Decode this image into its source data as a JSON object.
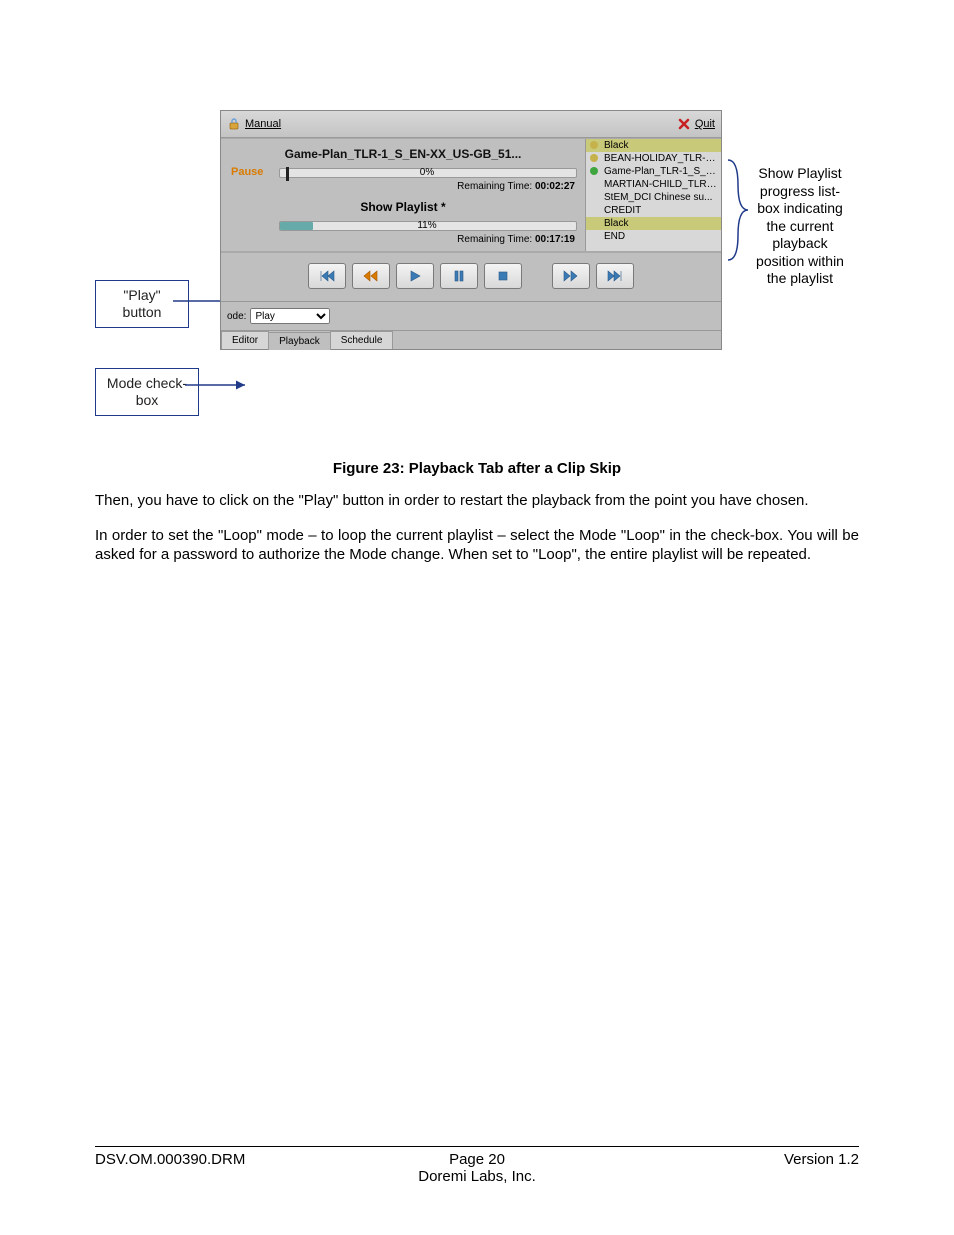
{
  "titlebar": {
    "manual": "Manual",
    "quit": "Quit"
  },
  "clip": {
    "title": "Game-Plan_TLR-1_S_EN-XX_US-GB_51...",
    "status": "Pause",
    "pct_label": "0%",
    "cursor_pct": 2,
    "remaining_label": "Remaining Time:",
    "remaining_val": "00:02:27"
  },
  "show": {
    "title": "Show Playlist *",
    "pct_label": "11%",
    "fill_pct": 11,
    "remaining_label": "Remaining Time:",
    "remaining_val": "00:17:19"
  },
  "playlist": [
    {
      "label": "Black",
      "selected": true,
      "dot": "#c6b24a"
    },
    {
      "label": "BEAN-HOLIDAY_TLR-1R...",
      "dot": "#c6b24a"
    },
    {
      "label": "Game-Plan_TLR-1_S_E...",
      "dot": "#3fa53f"
    },
    {
      "label": "MARTIAN-CHILD_TLR-1...",
      "dot": ""
    },
    {
      "label": "StEM_DCI Chinese su...",
      "dot": ""
    },
    {
      "label": "CREDIT",
      "dot": ""
    },
    {
      "label": "Black",
      "selected": true,
      "dot": ""
    },
    {
      "label": "END",
      "dot": ""
    }
  ],
  "mode": {
    "label": "ode:",
    "value": "Play"
  },
  "tabs": [
    "Editor",
    "Playback",
    "Schedule"
  ],
  "active_tab": 1,
  "callouts": {
    "play": "\"Play\" button",
    "mode": "Mode check-box",
    "right": "Show Playlist progress list-box indicating the current playback position within the playlist"
  },
  "caption": "Figure 23: Playback Tab after a Clip Skip",
  "para1": "Then, you have to click on the \"Play\" button in order to restart the playback from the point you have chosen.",
  "para2": "In order to set the \"Loop\" mode – to loop the current playlist – select the Mode \"Loop\" in the check-box. You will be asked for a password to authorize the Mode change. When set to \"Loop\", the entire playlist will be repeated.",
  "footer": {
    "left": "DSV.OM.000390.DRM",
    "center_top": "Page 20",
    "center_bottom": "Doremi Labs, Inc.",
    "right": "Version 1.2"
  }
}
